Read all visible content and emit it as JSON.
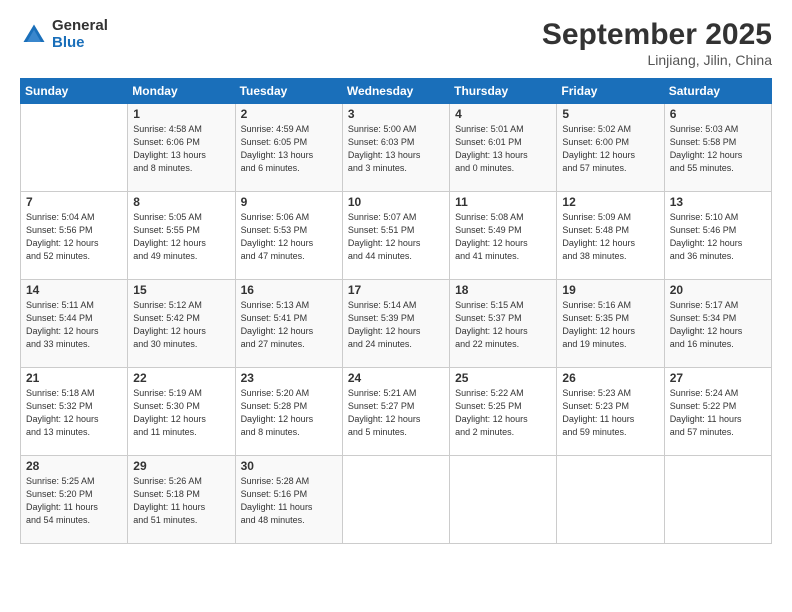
{
  "header": {
    "logo_general": "General",
    "logo_blue": "Blue",
    "month_title": "September 2025",
    "location": "Linjiang, Jilin, China"
  },
  "days_of_week": [
    "Sunday",
    "Monday",
    "Tuesday",
    "Wednesday",
    "Thursday",
    "Friday",
    "Saturday"
  ],
  "weeks": [
    [
      {
        "day": "",
        "info": ""
      },
      {
        "day": "1",
        "info": "Sunrise: 4:58 AM\nSunset: 6:06 PM\nDaylight: 13 hours\nand 8 minutes."
      },
      {
        "day": "2",
        "info": "Sunrise: 4:59 AM\nSunset: 6:05 PM\nDaylight: 13 hours\nand 6 minutes."
      },
      {
        "day": "3",
        "info": "Sunrise: 5:00 AM\nSunset: 6:03 PM\nDaylight: 13 hours\nand 3 minutes."
      },
      {
        "day": "4",
        "info": "Sunrise: 5:01 AM\nSunset: 6:01 PM\nDaylight: 13 hours\nand 0 minutes."
      },
      {
        "day": "5",
        "info": "Sunrise: 5:02 AM\nSunset: 6:00 PM\nDaylight: 12 hours\nand 57 minutes."
      },
      {
        "day": "6",
        "info": "Sunrise: 5:03 AM\nSunset: 5:58 PM\nDaylight: 12 hours\nand 55 minutes."
      }
    ],
    [
      {
        "day": "7",
        "info": "Sunrise: 5:04 AM\nSunset: 5:56 PM\nDaylight: 12 hours\nand 52 minutes."
      },
      {
        "day": "8",
        "info": "Sunrise: 5:05 AM\nSunset: 5:55 PM\nDaylight: 12 hours\nand 49 minutes."
      },
      {
        "day": "9",
        "info": "Sunrise: 5:06 AM\nSunset: 5:53 PM\nDaylight: 12 hours\nand 47 minutes."
      },
      {
        "day": "10",
        "info": "Sunrise: 5:07 AM\nSunset: 5:51 PM\nDaylight: 12 hours\nand 44 minutes."
      },
      {
        "day": "11",
        "info": "Sunrise: 5:08 AM\nSunset: 5:49 PM\nDaylight: 12 hours\nand 41 minutes."
      },
      {
        "day": "12",
        "info": "Sunrise: 5:09 AM\nSunset: 5:48 PM\nDaylight: 12 hours\nand 38 minutes."
      },
      {
        "day": "13",
        "info": "Sunrise: 5:10 AM\nSunset: 5:46 PM\nDaylight: 12 hours\nand 36 minutes."
      }
    ],
    [
      {
        "day": "14",
        "info": "Sunrise: 5:11 AM\nSunset: 5:44 PM\nDaylight: 12 hours\nand 33 minutes."
      },
      {
        "day": "15",
        "info": "Sunrise: 5:12 AM\nSunset: 5:42 PM\nDaylight: 12 hours\nand 30 minutes."
      },
      {
        "day": "16",
        "info": "Sunrise: 5:13 AM\nSunset: 5:41 PM\nDaylight: 12 hours\nand 27 minutes."
      },
      {
        "day": "17",
        "info": "Sunrise: 5:14 AM\nSunset: 5:39 PM\nDaylight: 12 hours\nand 24 minutes."
      },
      {
        "day": "18",
        "info": "Sunrise: 5:15 AM\nSunset: 5:37 PM\nDaylight: 12 hours\nand 22 minutes."
      },
      {
        "day": "19",
        "info": "Sunrise: 5:16 AM\nSunset: 5:35 PM\nDaylight: 12 hours\nand 19 minutes."
      },
      {
        "day": "20",
        "info": "Sunrise: 5:17 AM\nSunset: 5:34 PM\nDaylight: 12 hours\nand 16 minutes."
      }
    ],
    [
      {
        "day": "21",
        "info": "Sunrise: 5:18 AM\nSunset: 5:32 PM\nDaylight: 12 hours\nand 13 minutes."
      },
      {
        "day": "22",
        "info": "Sunrise: 5:19 AM\nSunset: 5:30 PM\nDaylight: 12 hours\nand 11 minutes."
      },
      {
        "day": "23",
        "info": "Sunrise: 5:20 AM\nSunset: 5:28 PM\nDaylight: 12 hours\nand 8 minutes."
      },
      {
        "day": "24",
        "info": "Sunrise: 5:21 AM\nSunset: 5:27 PM\nDaylight: 12 hours\nand 5 minutes."
      },
      {
        "day": "25",
        "info": "Sunrise: 5:22 AM\nSunset: 5:25 PM\nDaylight: 12 hours\nand 2 minutes."
      },
      {
        "day": "26",
        "info": "Sunrise: 5:23 AM\nSunset: 5:23 PM\nDaylight: 11 hours\nand 59 minutes."
      },
      {
        "day": "27",
        "info": "Sunrise: 5:24 AM\nSunset: 5:22 PM\nDaylight: 11 hours\nand 57 minutes."
      }
    ],
    [
      {
        "day": "28",
        "info": "Sunrise: 5:25 AM\nSunset: 5:20 PM\nDaylight: 11 hours\nand 54 minutes."
      },
      {
        "day": "29",
        "info": "Sunrise: 5:26 AM\nSunset: 5:18 PM\nDaylight: 11 hours\nand 51 minutes."
      },
      {
        "day": "30",
        "info": "Sunrise: 5:28 AM\nSunset: 5:16 PM\nDaylight: 11 hours\nand 48 minutes."
      },
      {
        "day": "",
        "info": ""
      },
      {
        "day": "",
        "info": ""
      },
      {
        "day": "",
        "info": ""
      },
      {
        "day": "",
        "info": ""
      }
    ]
  ]
}
